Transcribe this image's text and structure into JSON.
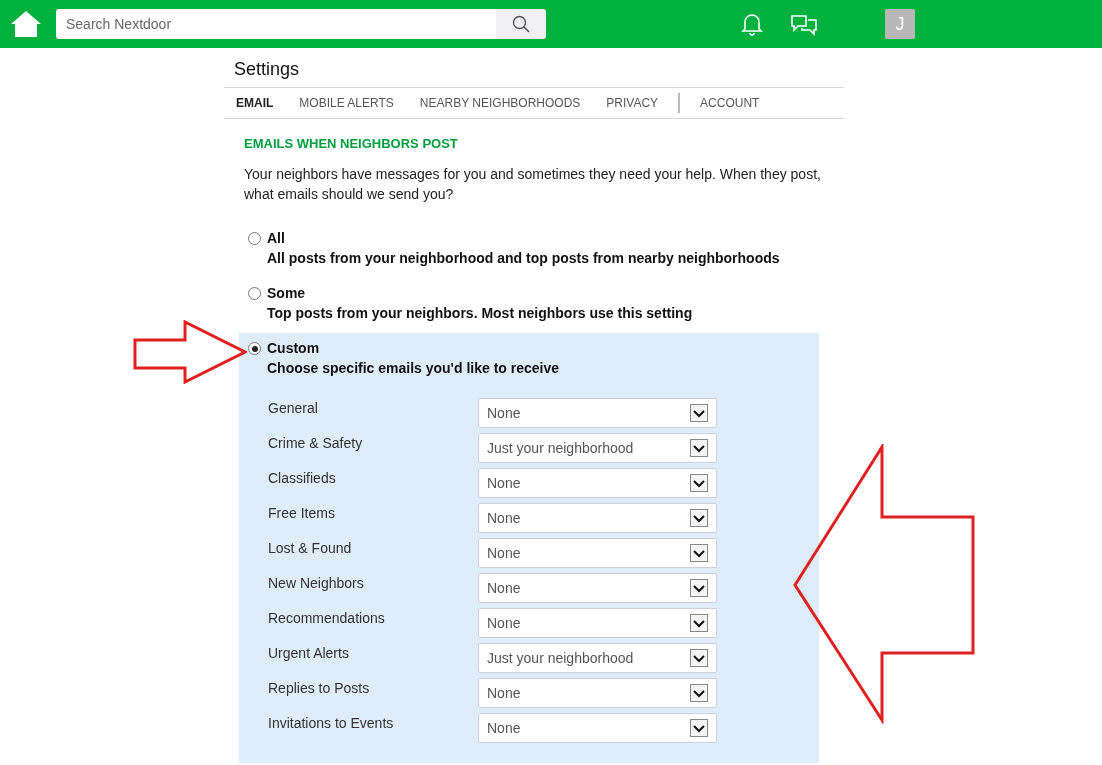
{
  "search": {
    "placeholder": "Search Nextdoor"
  },
  "avatar": {
    "initial": "J"
  },
  "page_title": "Settings",
  "tabs": [
    {
      "label": "EMAIL",
      "selected": true
    },
    {
      "label": "MOBILE ALERTS",
      "selected": false
    },
    {
      "label": "NEARBY NEIGHBORHOODS",
      "selected": false
    },
    {
      "label": "PRIVACY",
      "selected": false
    },
    {
      "label": "ACCOUNT",
      "selected": false
    }
  ],
  "section_title": "EMAILS WHEN NEIGHBORS POST",
  "intro": "Your neighbors have messages for you and sometimes they need your help. When they post, what emails should we send you?",
  "options": [
    {
      "label": "All",
      "description": "All posts from your neighborhood and top posts from nearby neighborhoods",
      "selected": false
    },
    {
      "label": "Some",
      "description": "Top posts from your neighbors. Most neighbors use this setting",
      "selected": false
    },
    {
      "label": "Custom",
      "description": "Choose specific emails you'd like to receive",
      "selected": true
    }
  ],
  "custom_settings": [
    {
      "label": "General",
      "value": "None"
    },
    {
      "label": "Crime & Safety",
      "value": "Just your neighborhood"
    },
    {
      "label": "Classifieds",
      "value": "None"
    },
    {
      "label": "Free Items",
      "value": "None"
    },
    {
      "label": "Lost & Found",
      "value": "None"
    },
    {
      "label": "New Neighbors",
      "value": "None"
    },
    {
      "label": "Recommendations",
      "value": "None"
    },
    {
      "label": "Urgent Alerts",
      "value": "Just your neighborhood"
    },
    {
      "label": "Replies to Posts",
      "value": "None"
    },
    {
      "label": "Invitations to Events",
      "value": "None"
    }
  ]
}
